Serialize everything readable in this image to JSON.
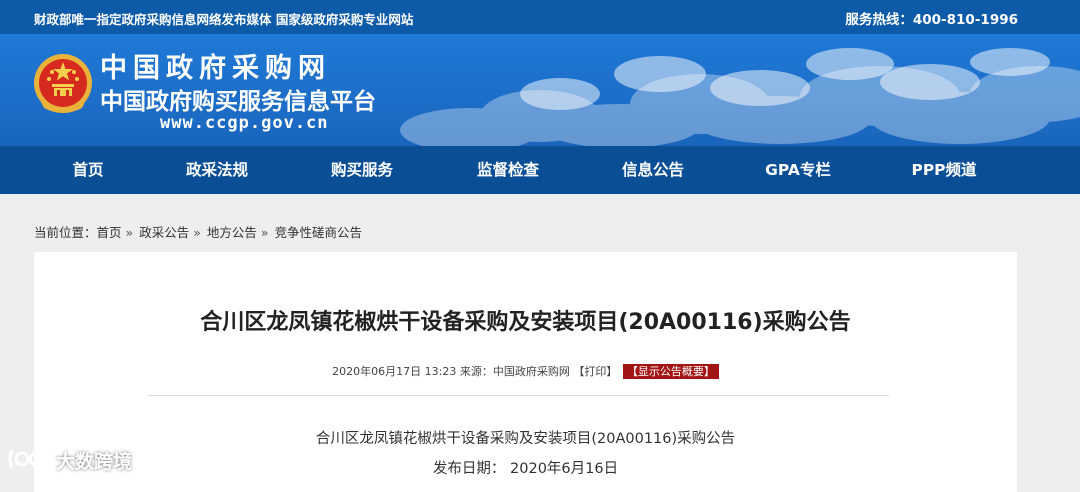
{
  "topbar": {
    "left_text": "财政部唯一指定政府采购信息网络发布媒体 国家级政府采购专业网站",
    "hotline": "服务热线：400-810-1996"
  },
  "banner": {
    "site_name": "中国政府采购网",
    "platform_name": "中国政府购买服务信息平台",
    "url": "www.ccgp.gov.cn"
  },
  "nav": {
    "items": [
      "首页",
      "政采法规",
      "购买服务",
      "监督检查",
      "信息公告",
      "GPA专栏",
      "PPP频道"
    ]
  },
  "breadcrumb": {
    "prefix": "当前位置：",
    "items": [
      "首页",
      "政采公告",
      "地方公告",
      "竞争性磋商公告"
    ],
    "separator": "»"
  },
  "article": {
    "title": "合川区龙凤镇花椒烘干设备采购及安装项目(20A00116)采购公告",
    "meta": "2020年06月17日 13:23 来源：中国政府采购网 【打印】",
    "summary_button": "【显示公告概要】",
    "body_title": "合川区龙凤镇花椒烘干设备采购及安装项目(20A00116)采购公告",
    "publish_date": "发布日期： 2020年6月16日"
  },
  "watermark": {
    "text": "大数跨境"
  },
  "colors": {
    "topbar": "#0c5aa8",
    "banner": "#1f79d6",
    "nav": "#0a4f96",
    "summary_badge": "#a31515"
  }
}
